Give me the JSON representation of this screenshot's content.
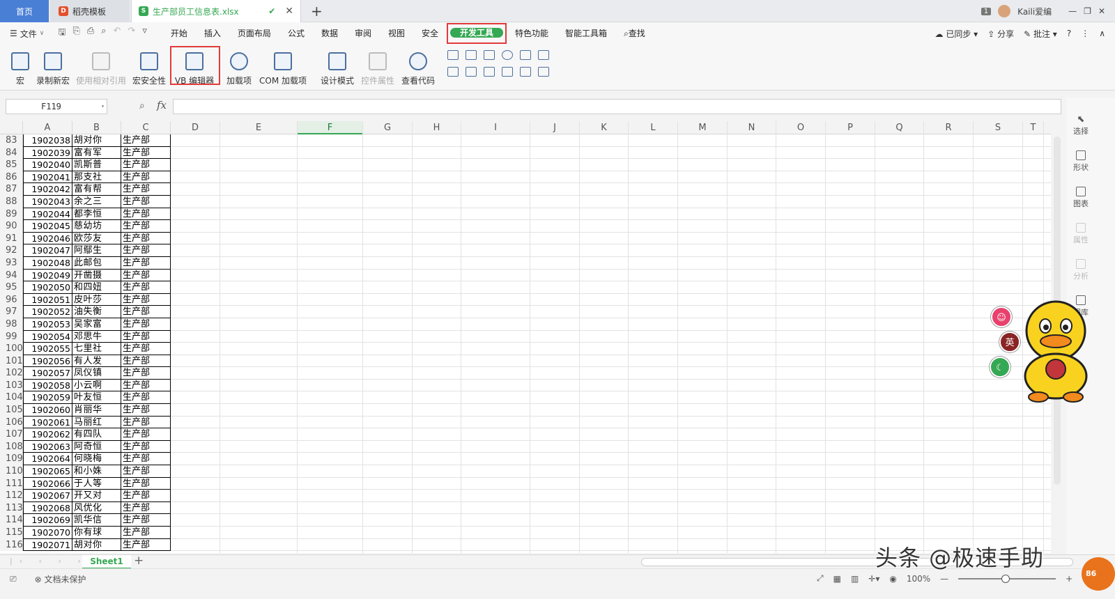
{
  "titlebar": {
    "home_tab": "首页",
    "doc_tab": "稻壳模板",
    "file_tab": "生产部员工信息表.xlsx",
    "badge": "1",
    "user": "Kaili爱编"
  },
  "menubar": {
    "file": "文件",
    "items": [
      "开始",
      "插入",
      "页面布局",
      "公式",
      "数据",
      "审阅",
      "视图",
      "安全"
    ],
    "active": "开发工具",
    "items2": [
      "特色功能",
      "智能工具箱"
    ],
    "search": "查找",
    "sync": "已同步",
    "share": "分享",
    "comment": "批注",
    "help": "?"
  },
  "ribbon": {
    "buttons": [
      "宏",
      "录制新宏",
      "使用相对引用",
      "宏安全性",
      "VB 编辑器",
      "加载项",
      "COM 加载项",
      "设计模式",
      "控件属性",
      "查看代码"
    ]
  },
  "formula": {
    "cell_ref": "F119",
    "fx": "fx",
    "value": ""
  },
  "grid": {
    "columns": [
      "A",
      "B",
      "C",
      "D",
      "E",
      "F",
      "G",
      "H",
      "I",
      "J",
      "K",
      "L",
      "M",
      "N",
      "O",
      "P",
      "Q",
      "R",
      "S",
      "T"
    ],
    "selected_column": "F",
    "rows": [
      {
        "n": "83",
        "id": "1902038",
        "name": "胡对你",
        "dept": "生产部"
      },
      {
        "n": "84",
        "id": "1902039",
        "name": "富有军",
        "dept": "生产部"
      },
      {
        "n": "85",
        "id": "1902040",
        "name": "凯斯普",
        "dept": "生产部"
      },
      {
        "n": "86",
        "id": "1902041",
        "name": "那支社",
        "dept": "生产部"
      },
      {
        "n": "87",
        "id": "1902042",
        "name": "富有帮",
        "dept": "生产部"
      },
      {
        "n": "88",
        "id": "1902043",
        "name": "余之三",
        "dept": "生产部"
      },
      {
        "n": "89",
        "id": "1902044",
        "name": "都李恒",
        "dept": "生产部"
      },
      {
        "n": "90",
        "id": "1902045",
        "name": "慈幼坊",
        "dept": "生产部"
      },
      {
        "n": "91",
        "id": "1902046",
        "name": "欧莎友",
        "dept": "生产部"
      },
      {
        "n": "92",
        "id": "1902047",
        "name": "阿鄢生",
        "dept": "生产部"
      },
      {
        "n": "93",
        "id": "1902048",
        "name": "此邮包",
        "dept": "生产部"
      },
      {
        "n": "94",
        "id": "1902049",
        "name": "开凿摄",
        "dept": "生产部"
      },
      {
        "n": "95",
        "id": "1902050",
        "name": "和四妞",
        "dept": "生产部"
      },
      {
        "n": "96",
        "id": "1902051",
        "name": "皮叶莎",
        "dept": "生产部"
      },
      {
        "n": "97",
        "id": "1902052",
        "name": "油失衡",
        "dept": "生产部"
      },
      {
        "n": "98",
        "id": "1902053",
        "name": "吴家富",
        "dept": "生产部"
      },
      {
        "n": "99",
        "id": "1902054",
        "name": "邓思牛",
        "dept": "生产部"
      },
      {
        "n": "100",
        "id": "1902055",
        "name": "七里社",
        "dept": "生产部"
      },
      {
        "n": "101",
        "id": "1902056",
        "name": "有人发",
        "dept": "生产部"
      },
      {
        "n": "102",
        "id": "1902057",
        "name": "凤仪镇",
        "dept": "生产部"
      },
      {
        "n": "103",
        "id": "1902058",
        "name": "小云啊",
        "dept": "生产部"
      },
      {
        "n": "104",
        "id": "1902059",
        "name": "叶友恒",
        "dept": "生产部"
      },
      {
        "n": "105",
        "id": "1902060",
        "name": "肖丽华",
        "dept": "生产部"
      },
      {
        "n": "106",
        "id": "1902061",
        "name": "马丽红",
        "dept": "生产部"
      },
      {
        "n": "107",
        "id": "1902062",
        "name": "有四队",
        "dept": "生产部"
      },
      {
        "n": "108",
        "id": "1902063",
        "name": "阿奇恒",
        "dept": "生产部"
      },
      {
        "n": "109",
        "id": "1902064",
        "name": "何晓梅",
        "dept": "生产部"
      },
      {
        "n": "110",
        "id": "1902065",
        "name": "和小姝",
        "dept": "生产部"
      },
      {
        "n": "111",
        "id": "1902066",
        "name": "于人等",
        "dept": "生产部"
      },
      {
        "n": "112",
        "id": "1902067",
        "name": "开又对",
        "dept": "生产部"
      },
      {
        "n": "113",
        "id": "1902068",
        "name": "风优化",
        "dept": "生产部"
      },
      {
        "n": "114",
        "id": "1902069",
        "name": "凯华信",
        "dept": "生产部"
      },
      {
        "n": "115",
        "id": "1902070",
        "name": "你有球",
        "dept": "生产部"
      },
      {
        "n": "116",
        "id": "1902071",
        "name": "胡对你",
        "dept": "生产部"
      }
    ]
  },
  "side_panel": [
    "选择",
    "形状",
    "图表",
    "属性",
    "分析",
    "图库"
  ],
  "sheets": {
    "active": "Sheet1",
    "add": "+"
  },
  "statusbar": {
    "protect": "文档未保护",
    "zoom": "100%"
  },
  "overlay": {
    "watermark": "头条 @极速手助",
    "bubble_cn": "英",
    "corner": "86"
  },
  "colors": {
    "accent": "#35a853",
    "highlight": "#e23a3a",
    "home_tab": "#4a7fd6"
  }
}
